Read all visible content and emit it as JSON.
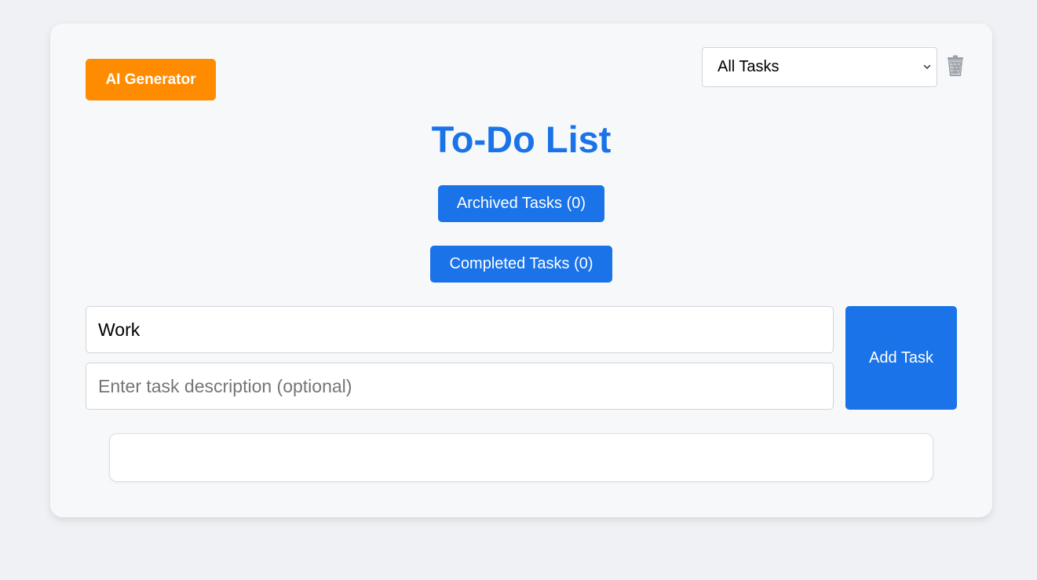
{
  "header": {
    "ai_generator_label": "AI Generator",
    "filter_selected": "All Tasks",
    "trash_icon": "trash-icon"
  },
  "main": {
    "title": "To-Do List",
    "archived_label": "Archived Tasks (0)",
    "completed_label": "Completed Tasks (0)"
  },
  "form": {
    "title_value": "Work",
    "description_value": "",
    "description_placeholder": "Enter task description (optional)",
    "add_label": "Add Task"
  },
  "colors": {
    "accent": "#1a73e8",
    "ai_button": "#ff8c00",
    "background": "#eff1f5",
    "card": "#f7f8fa"
  }
}
